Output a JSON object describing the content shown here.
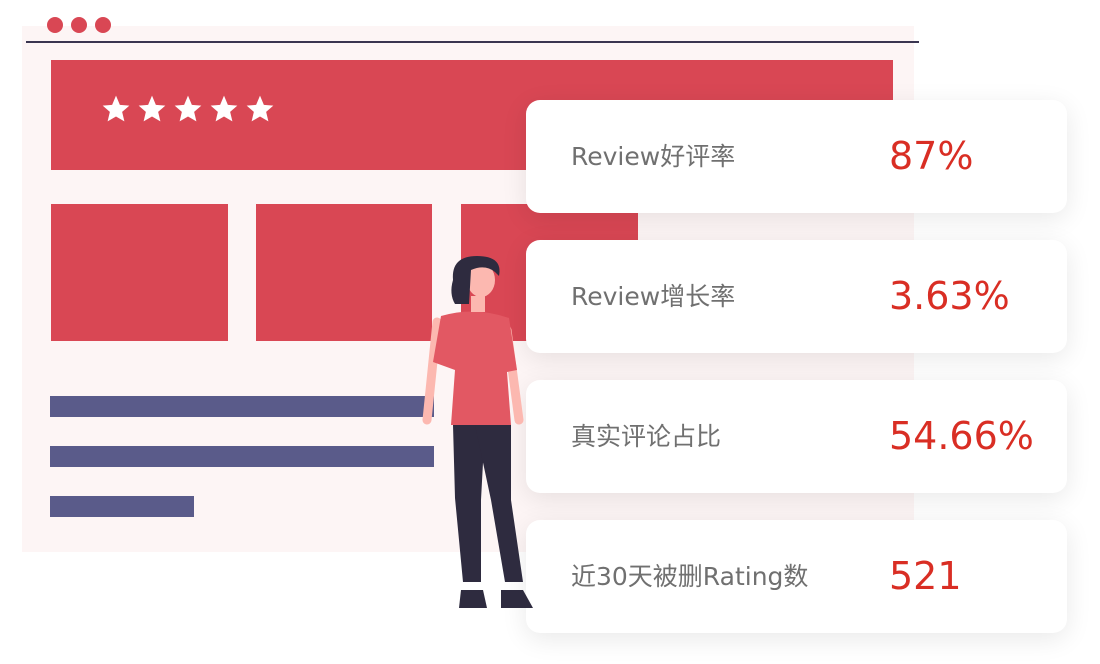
{
  "colors": {
    "accent": "#d94754",
    "value_red": "#d92e24",
    "bar_navy": "#5a5b8a",
    "dark": "#2e2b3f",
    "skin": "#fcb8b0"
  },
  "illustration": {
    "window_dots": [
      "dot",
      "dot",
      "dot"
    ],
    "rating_stars": 5,
    "icon": "five-star-rating"
  },
  "metrics": [
    {
      "label": "Review好评率",
      "value": "87%"
    },
    {
      "label": "Review增长率",
      "value": "3.63%"
    },
    {
      "label": "真实评论占比",
      "value": "54.66%"
    },
    {
      "label": "近30天被删Rating数",
      "value": "521"
    }
  ]
}
